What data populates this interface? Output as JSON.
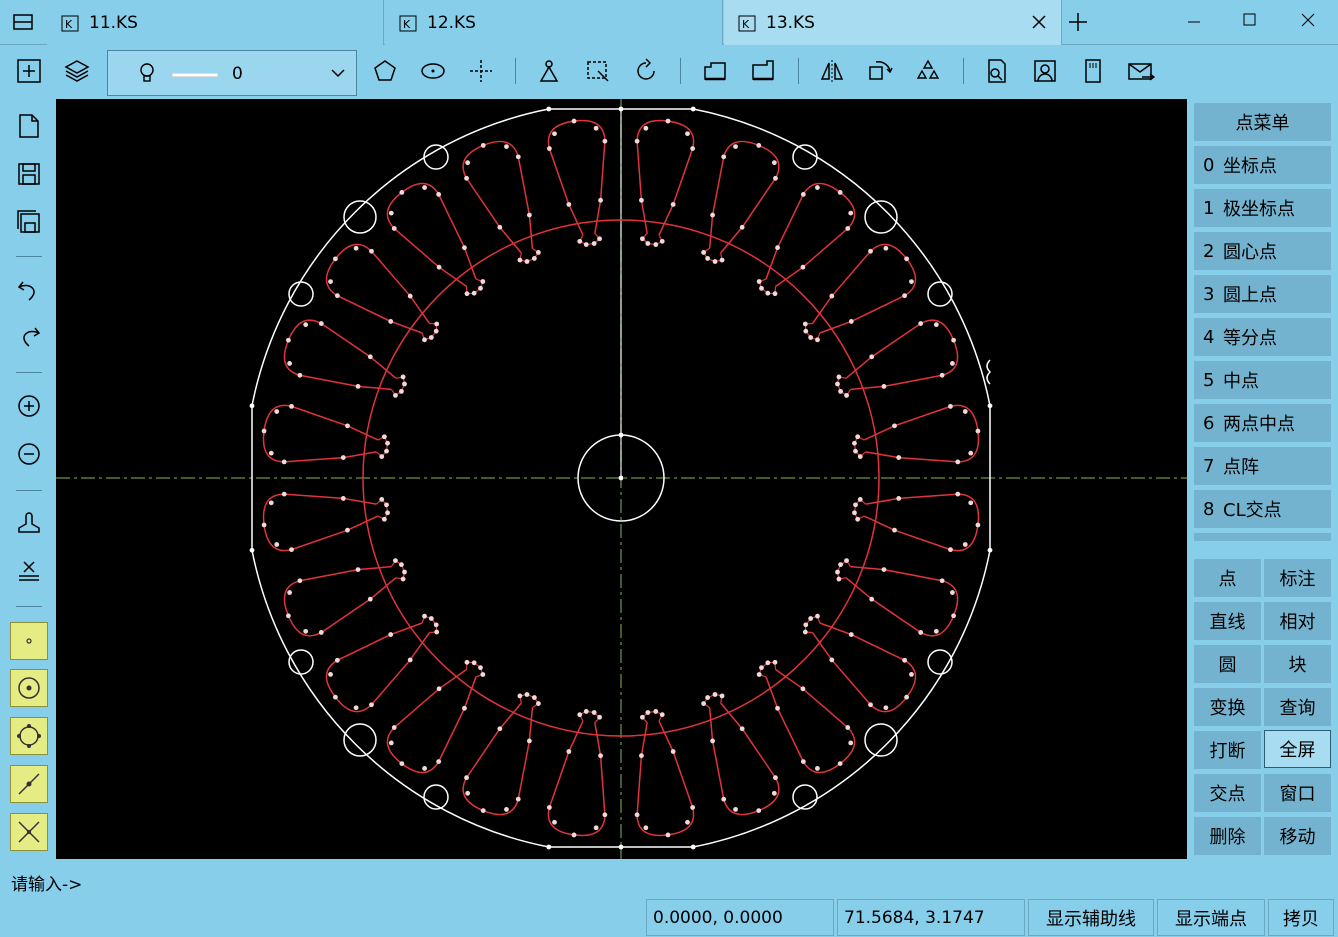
{
  "tabs": [
    {
      "label": "11.KS",
      "active": false
    },
    {
      "label": "12.KS",
      "active": false
    },
    {
      "label": "13.KS",
      "active": true
    }
  ],
  "toolbar": {
    "layer_value": "0",
    "icons": [
      "new-drawing-icon",
      "layers-icon",
      "polygon-icon",
      "ellipse-icon",
      "crosshair-icon",
      "mirror-icon",
      "select-move-icon",
      "rotate-icon",
      "offset-icon",
      "stretch-icon",
      "flip-icon",
      "array-icon",
      "triangle-array-icon",
      "lookup-icon",
      "portrait-icon",
      "memory-card-icon",
      "export-icon"
    ]
  },
  "left_toolbar": {
    "icons": [
      "new-file-icon",
      "save-icon",
      "save-as-icon",
      "undo-icon",
      "redo-icon",
      "zoom-in-icon",
      "zoom-out-icon",
      "pan-icon",
      "delete-icon"
    ],
    "snap_buttons": [
      "snap-point-icon",
      "snap-center-icon",
      "snap-quadrant-icon",
      "snap-midpoint-icon",
      "snap-intersection-icon"
    ]
  },
  "right_panel": {
    "title": "点菜单",
    "items": [
      {
        "num": "0",
        "label": "坐标点"
      },
      {
        "num": "1",
        "label": "极坐标点"
      },
      {
        "num": "2",
        "label": "圆心点"
      },
      {
        "num": "3",
        "label": "圆上点"
      },
      {
        "num": "4",
        "label": "等分点"
      },
      {
        "num": "5",
        "label": "中点"
      },
      {
        "num": "6",
        "label": "两点中点"
      },
      {
        "num": "7",
        "label": "点阵"
      },
      {
        "num": "8",
        "label": "CL交点"
      }
    ],
    "grid": [
      [
        "点",
        "标注"
      ],
      [
        "直线",
        "相对"
      ],
      [
        "圆",
        "块"
      ],
      [
        "变换",
        "查询"
      ],
      [
        "打断",
        "全屏"
      ],
      [
        "交点",
        "窗口"
      ],
      [
        "删除",
        "移动"
      ]
    ],
    "selected": "全屏"
  },
  "command_prompt": "请输入->",
  "status": {
    "coord1": "0.0000, 0.0000",
    "coord2": "71.5684, 3.1747",
    "btn_aux": "显示辅助线",
    "btn_end": "显示端点",
    "btn_copy": "拷贝"
  },
  "colors": {
    "background": "#87CEEB",
    "canvas": "#000000",
    "outline": "#ffffff",
    "slots": "#e0343a",
    "centerline": "#5a7a3a"
  },
  "drawing": {
    "slot_count": 24,
    "mount_holes": 12
  }
}
